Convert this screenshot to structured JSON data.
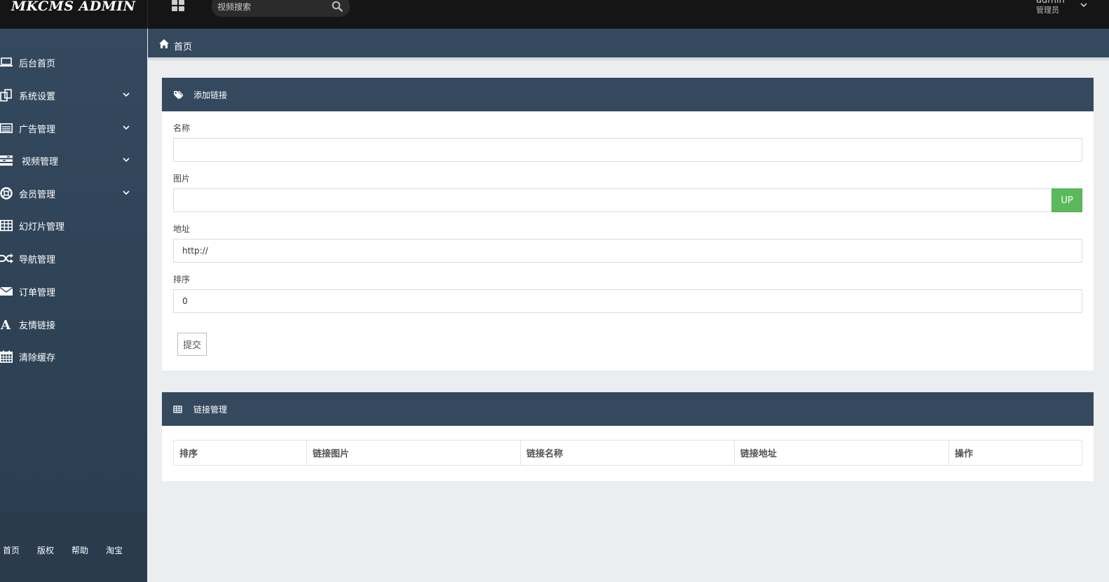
{
  "app": {
    "logo_text": "MKCMS ADMIN"
  },
  "topbar": {
    "search_placeholder": "视频搜索",
    "user_name": "admin",
    "user_role": "管理员"
  },
  "sidebar": {
    "items": [
      {
        "label": "后台首页",
        "icon": "laptop-icon",
        "has_submenu": false
      },
      {
        "label": "系统设置",
        "icon": "copy-icon",
        "has_submenu": true
      },
      {
        "label": "广告管理",
        "icon": "list-alt-icon",
        "has_submenu": true
      },
      {
        "label": "视频管理",
        "icon": "tasks-icon",
        "has_submenu": true
      },
      {
        "label": "会员管理",
        "icon": "life-ring-icon",
        "has_submenu": true
      },
      {
        "label": "幻灯片管理",
        "icon": "table-icon",
        "has_submenu": false
      },
      {
        "label": "导航管理",
        "icon": "random-icon",
        "has_submenu": false
      },
      {
        "label": "订单管理",
        "icon": "envelope-icon",
        "has_submenu": false
      },
      {
        "label": "友情链接",
        "icon": "font-icon",
        "has_submenu": false
      },
      {
        "label": "清除缓存",
        "icon": "calendar-icon",
        "has_submenu": false
      }
    ],
    "footer_links": [
      "首页",
      "版权",
      "帮助",
      "淘宝"
    ]
  },
  "breadcrumb": {
    "home_label": "首页"
  },
  "add_link_panel": {
    "title": "添加链接",
    "fields": {
      "name": {
        "label": "名称",
        "value": ""
      },
      "image": {
        "label": "图片",
        "value": "",
        "button": "UP"
      },
      "url": {
        "label": "地址",
        "value": "http://"
      },
      "sort": {
        "label": "排序",
        "value": "0"
      }
    },
    "submit_label": "提交"
  },
  "link_manage_panel": {
    "title": "链接管理",
    "columns": [
      "排序",
      "链接图片",
      "链接名称",
      "链接地址",
      "操作"
    ],
    "rows": []
  },
  "colors": {
    "topbar_bg": "#151515",
    "sidebar_bg": "#34495e",
    "panel_header_bg": "#34495e",
    "upload_button": "#5cb85c",
    "page_bg": "#ebedef"
  }
}
